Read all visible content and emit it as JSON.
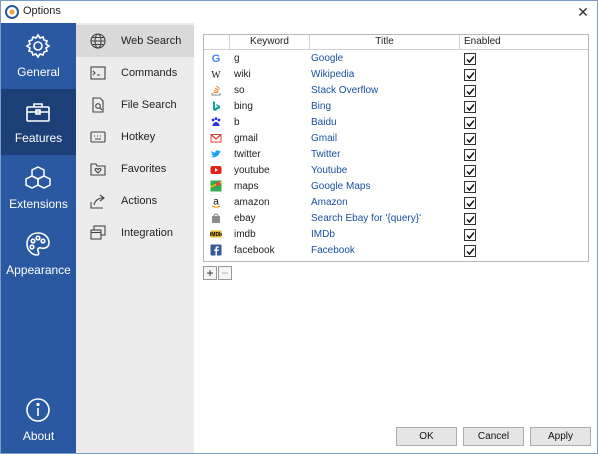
{
  "window": {
    "title": "Options",
    "close_glyph": "✕"
  },
  "left_nav": [
    {
      "label": "General",
      "icon": "gear-icon",
      "active": false
    },
    {
      "label": "Features",
      "icon": "briefcase-icon",
      "active": true
    },
    {
      "label": "Extensions",
      "icon": "cubes-icon",
      "active": false
    },
    {
      "label": "Appearance",
      "icon": "palette-icon",
      "active": false
    },
    {
      "label": "About",
      "icon": "info-icon",
      "active": false
    }
  ],
  "sub_nav": [
    {
      "label": "Web Search",
      "icon": "globe-icon",
      "active": true
    },
    {
      "label": "Commands",
      "icon": "terminal-icon",
      "active": false
    },
    {
      "label": "File Search",
      "icon": "file-search-icon",
      "active": false
    },
    {
      "label": "Hotkey",
      "icon": "keyboard-icon",
      "active": false
    },
    {
      "label": "Favorites",
      "icon": "heart-folder-icon",
      "active": false
    },
    {
      "label": "Actions",
      "icon": "share-arrow-icon",
      "active": false
    },
    {
      "label": "Integration",
      "icon": "windows-stack-icon",
      "active": false
    }
  ],
  "table": {
    "headers": {
      "keyword": "Keyword",
      "title": "Title",
      "enabled": "Enabled"
    },
    "rows": [
      {
        "keyword": "g",
        "title": "Google",
        "enabled": true,
        "icon": "google-icon"
      },
      {
        "keyword": "wiki",
        "title": "Wikipedia",
        "enabled": true,
        "icon": "wikipedia-icon"
      },
      {
        "keyword": "so",
        "title": "Stack Overflow",
        "enabled": true,
        "icon": "stackoverflow-icon"
      },
      {
        "keyword": "bing",
        "title": "Bing",
        "enabled": true,
        "icon": "bing-icon"
      },
      {
        "keyword": "b",
        "title": "Baidu",
        "enabled": true,
        "icon": "baidu-icon"
      },
      {
        "keyword": "gmail",
        "title": "Gmail",
        "enabled": true,
        "icon": "gmail-icon"
      },
      {
        "keyword": "twitter",
        "title": "Twitter",
        "enabled": true,
        "icon": "twitter-icon"
      },
      {
        "keyword": "youtube",
        "title": "Youtube",
        "enabled": true,
        "icon": "youtube-icon"
      },
      {
        "keyword": "maps",
        "title": "Google Maps",
        "enabled": true,
        "icon": "maps-icon"
      },
      {
        "keyword": "amazon",
        "title": "Amazon",
        "enabled": true,
        "icon": "amazon-icon"
      },
      {
        "keyword": "ebay",
        "title": "Search Ebay for '{query}'",
        "enabled": true,
        "icon": "ebay-icon"
      },
      {
        "keyword": "imdb",
        "title": "IMDb",
        "enabled": true,
        "icon": "imdb-icon"
      },
      {
        "keyword": "facebook",
        "title": "Facebook",
        "enabled": true,
        "icon": "facebook-icon"
      }
    ]
  },
  "table_controls": {
    "add": "+",
    "remove": "−"
  },
  "buttons": {
    "ok": "OK",
    "cancel": "Cancel",
    "apply": "Apply"
  },
  "colors": {
    "nav_bg": "#2b59a1",
    "nav_active": "#1c3f78",
    "subnav_bg": "#ececec",
    "link": "#1a4f9e"
  }
}
